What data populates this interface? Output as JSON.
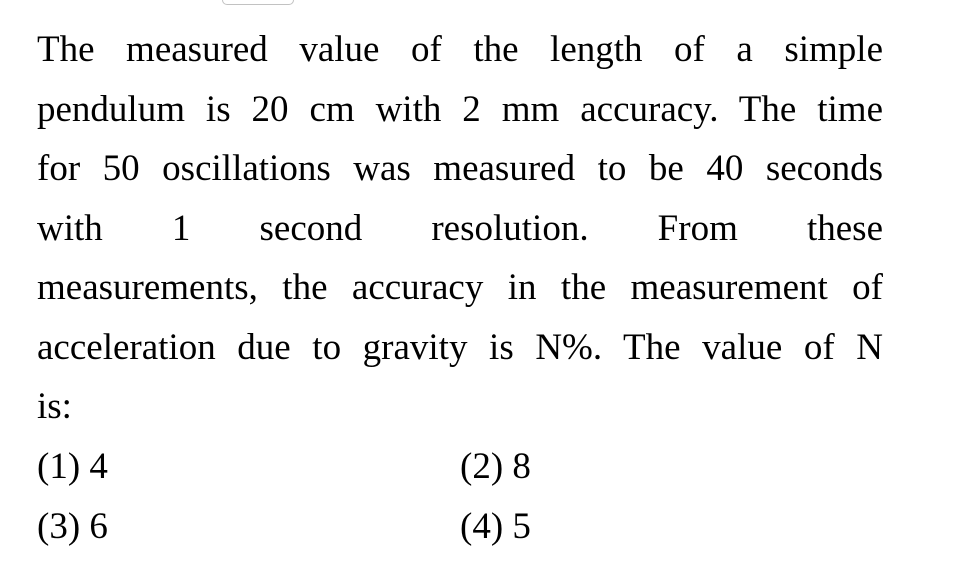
{
  "question": {
    "lines": [
      "The measured value of the length of a simple",
      "pendulum is 20 cm with 2 mm accuracy. The time",
      "for 50 oscillations was measured to be 40 seconds",
      "with 1 second resolution. From these",
      "measurements, the accuracy in the measurement of",
      "acceleration due to gravity is N%. The value of N",
      "is:"
    ]
  },
  "options": [
    {
      "label": "(1) 4"
    },
    {
      "label": "(2) 8"
    },
    {
      "label": "(3) 6"
    },
    {
      "label": "(4) 5"
    }
  ]
}
